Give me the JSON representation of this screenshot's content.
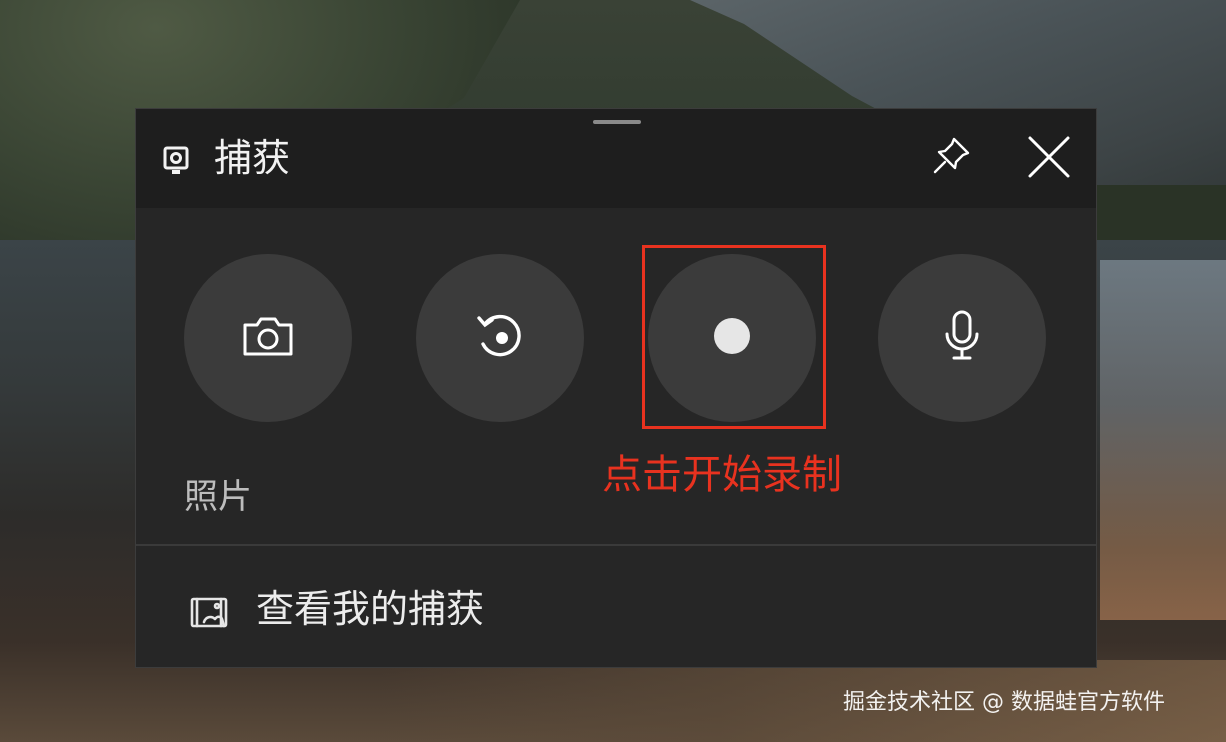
{
  "capture_widget": {
    "title": "捕获",
    "icons": {
      "title": "webcam-icon",
      "pin": "pin-icon",
      "close": "close-icon",
      "screenshot": "camera-icon",
      "recent": "replay-icon",
      "record": "record-dot-icon",
      "mic": "microphone-icon",
      "gallery": "gallery-icon"
    },
    "mode_label": "照片",
    "view_captures_label": "查看我的捕获"
  },
  "annotation": {
    "text": "点击开始录制",
    "color": "#e8321f"
  },
  "watermark": "掘金技术社区 @ 数据蛙官方软件"
}
